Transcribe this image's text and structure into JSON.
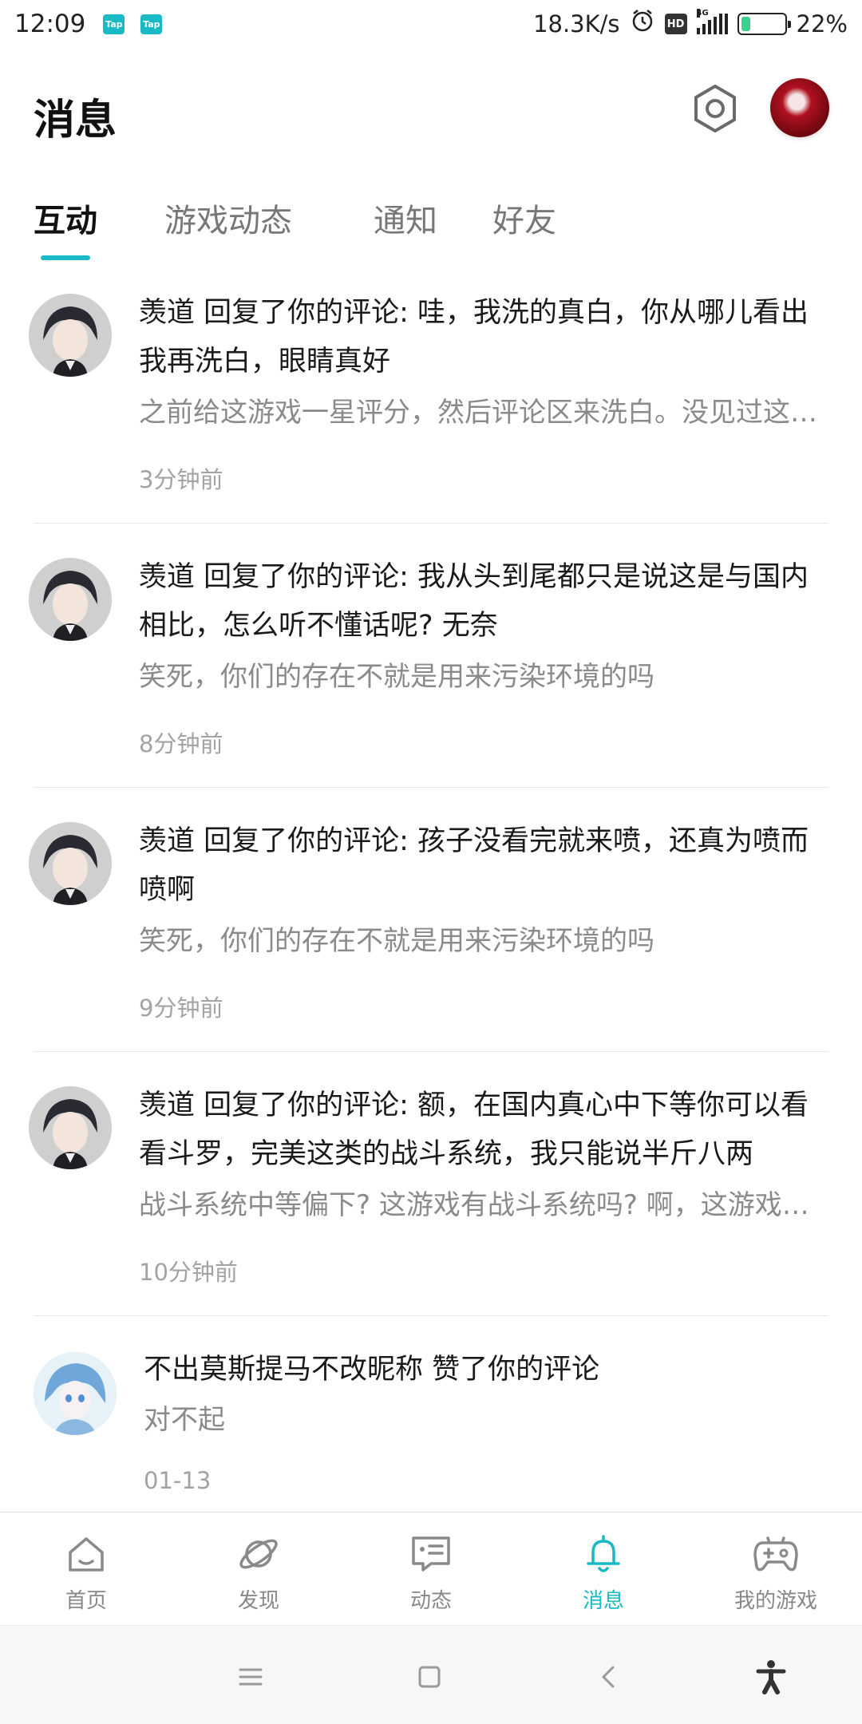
{
  "status_bar": {
    "time": "12:09",
    "app_badges": [
      "Tap",
      "Tap"
    ],
    "net_speed": "18.3K/s",
    "hd_label": "HD",
    "network_type": "4G",
    "battery_level": 0.22,
    "battery_text": "22%",
    "icons": [
      "alarm-icon",
      "hd-icon",
      "signal-icon",
      "battery-icon"
    ]
  },
  "header": {
    "title": "消息",
    "settings_icon": "settings-hexagon-icon",
    "avatar_icon": "profile-avatar"
  },
  "tabs": [
    {
      "label": "互动",
      "active": true
    },
    {
      "label": "游戏动态",
      "active": false
    },
    {
      "label": "通知",
      "active": false
    },
    {
      "label": "好友",
      "active": false
    }
  ],
  "messages": [
    {
      "title": "羡道 回复了你的评论: 哇，我洗的真白，你从哪儿看出我再洗白，眼睛真好",
      "preview": "之前给这游戏一星评分，然后评论区来洗白。没见过这么厚脸皮的人",
      "time": "3分钟前",
      "avatar": "dark-haired-boy-avatar"
    },
    {
      "title": "羡道 回复了你的评论: 我从头到尾都只是说这是与国内相比，怎么听不懂话呢? 无奈",
      "preview": "笑死，你们的存在不就是用来污染环境的吗",
      "time": "8分钟前",
      "avatar": "dark-haired-boy-avatar"
    },
    {
      "title": "羡道 回复了你的评论: 孩子没看完就来喷，还真为喷而喷啊",
      "preview": "笑死，你们的存在不就是用来污染环境的吗",
      "time": "9分钟前",
      "avatar": "dark-haired-boy-avatar"
    },
    {
      "title": "羡道 回复了你的评论: 额，在国内真心中下等你可以看看斗罗，完美这类的战斗系统，我只能说半斤八两",
      "preview": "战斗系统中等偏下? 这游戏有战斗系统吗? 啊，这游戏的战斗系统",
      "time": "10分钟前",
      "avatar": "dark-haired-boy-avatar"
    },
    {
      "title": "不出莫斯提马不改昵称 赞了你的评论",
      "preview": "对不起",
      "time": "01-13",
      "avatar": "blue-haired-anime-avatar"
    }
  ],
  "bottom_nav": [
    {
      "label": "首页",
      "icon": "home-icon",
      "active": false
    },
    {
      "label": "发现",
      "icon": "planet-icon",
      "active": false
    },
    {
      "label": "动态",
      "icon": "chat-card-icon",
      "active": false
    },
    {
      "label": "消息",
      "icon": "bell-icon",
      "active": true
    },
    {
      "label": "我的游戏",
      "icon": "gamepad-icon",
      "active": false
    }
  ],
  "system_nav": [
    "menu-icon",
    "home-square-icon",
    "back-icon",
    "accessibility-icon"
  ],
  "colors": {
    "accent": "#19b9c6",
    "text_primary": "#1a1a1a",
    "text_secondary": "#8a8a8a",
    "text_time": "#a3a3a3"
  }
}
